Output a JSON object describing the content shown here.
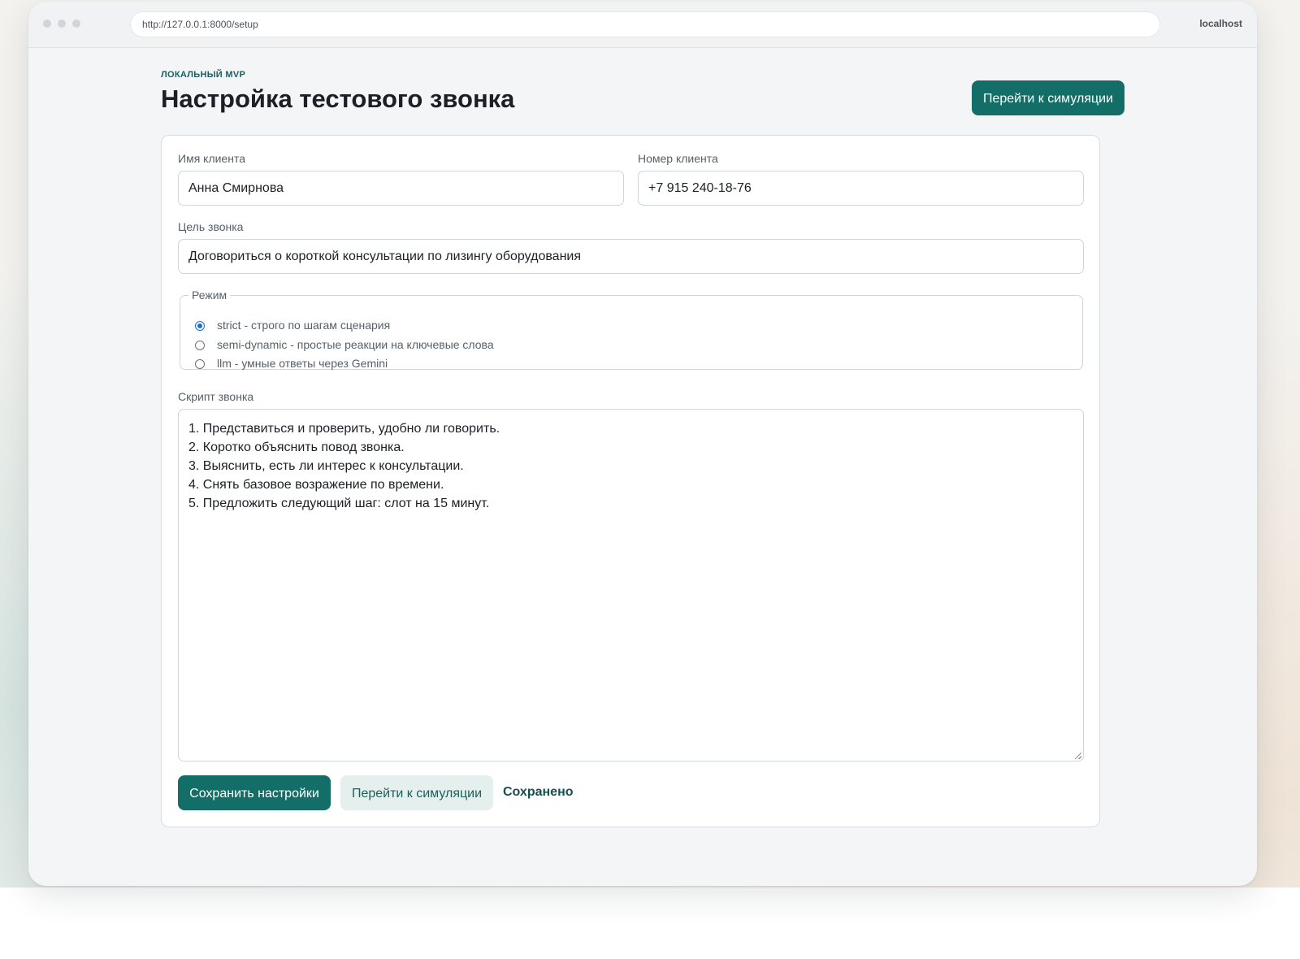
{
  "browser": {
    "url": "http://127.0.0.1:8000/setup",
    "host": "localhost"
  },
  "header": {
    "eyebrow": "ЛОКАЛЬНЫЙ MVP",
    "title": "Настройка тестового звонка",
    "simulation_button": "Перейти к симуляции"
  },
  "form": {
    "client_name": {
      "label": "Имя клиента",
      "value": "Анна Смирнова"
    },
    "client_phone": {
      "label": "Номер клиента",
      "value": "+7 915 240-18-76"
    },
    "call_goal": {
      "label": "Цель звонка",
      "value": "Договориться о короткой консультации по лизингу оборудования"
    },
    "mode": {
      "legend": "Режим",
      "options": [
        {
          "label": "strict - строго по шагам сценария",
          "checked": true
        },
        {
          "label": "semi-dynamic - простые реакции на ключевые слова",
          "checked": false
        },
        {
          "label": "llm - умные ответы через Gemini",
          "checked": false
        }
      ]
    },
    "script": {
      "label": "Скрипт звонка",
      "lines": [
        "1. Представиться и проверить, удобно ли говорить.",
        "2. Коротко объяснить повод звонка.",
        "3. Выяснить, есть ли интерес к консультации.",
        "4. Снять базовое возражение по времени.",
        "5. Предложить следующий шаг: слот на 15 минут."
      ]
    }
  },
  "actions": {
    "save_label": "Сохранить настройки",
    "simulation_label": "Перейти к симуляции",
    "status": "Сохранено"
  },
  "colors": {
    "primary": "#126e66",
    "secondary_bg": "#e5efed",
    "radio_accent": "#1a6fd6"
  }
}
